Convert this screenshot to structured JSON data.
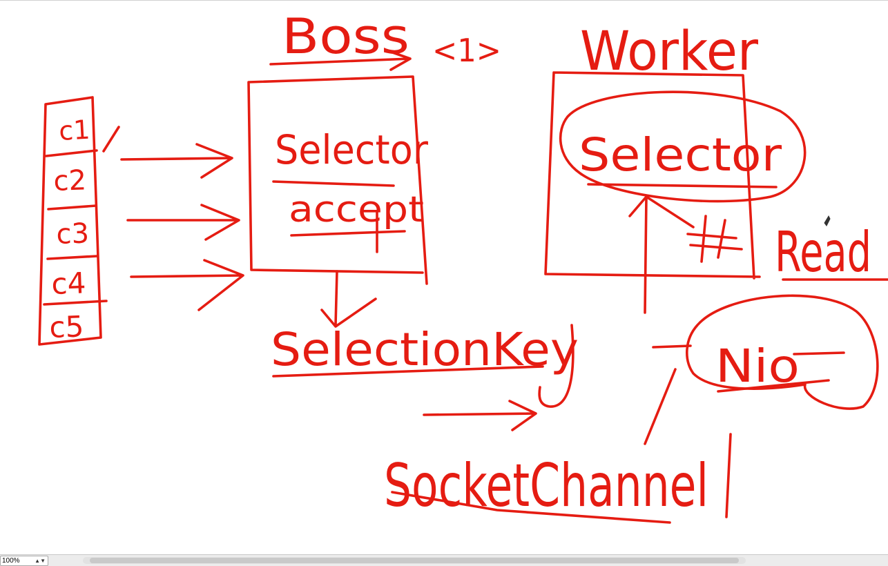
{
  "ink_color": "#e51c12",
  "labels": {
    "boss": "Boss",
    "boss_count": "<1>",
    "worker": "Worker",
    "boss_selector": "Selector",
    "accept": "accept",
    "worker_selector": "Selector",
    "selection_key": "SelectionKey",
    "socket_channel": "SocketChannel",
    "read": "Read",
    "nio": "Nio"
  },
  "clients": [
    "c1",
    "c2",
    "c3",
    "c4",
    "c5"
  ],
  "status_bar": {
    "zoom": "100%",
    "zoom_icon": "up-down-chevron-icon"
  }
}
